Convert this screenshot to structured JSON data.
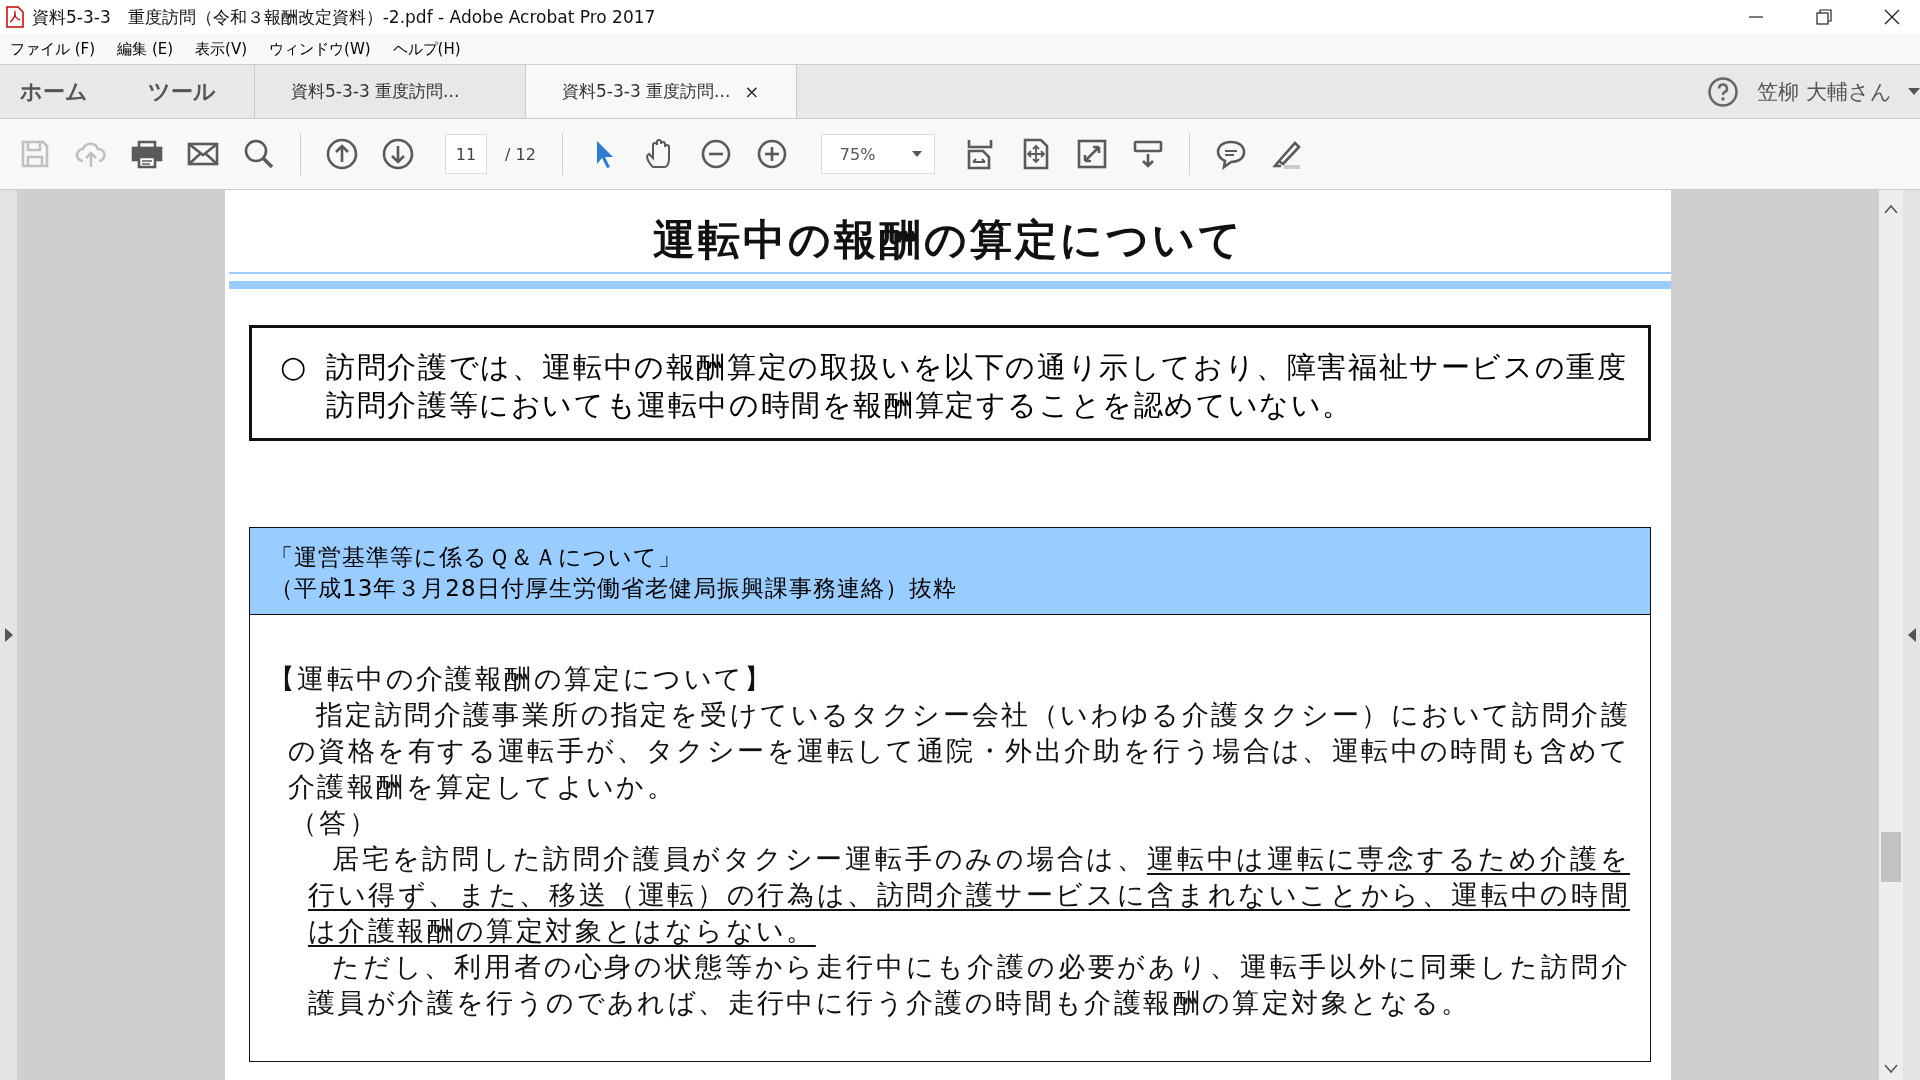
{
  "window": {
    "title": "資料5-3-3　重度訪問（令和３報酬改定資料）-2.pdf - Adobe Acrobat Pro 2017"
  },
  "menu": [
    "ファイル (F)",
    "編集 (E)",
    "表示(V)",
    "ウィンドウ(W)",
    "ヘルプ(H)"
  ],
  "nav_tabs": [
    "ホーム",
    "ツール"
  ],
  "doc_tabs": [
    {
      "label": "資料5-3-3  重度訪問...",
      "selected": false
    },
    {
      "label": "資料5-3-3  重度訪問...",
      "selected": true,
      "close": "×"
    }
  ],
  "user": {
    "name": "笠柳 大輔さん"
  },
  "toolbar": {
    "group_1": [
      {
        "kind": "save",
        "disabled": true
      },
      {
        "kind": "upload",
        "disabled": true
      },
      {
        "kind": "print",
        "disabled": false
      },
      {
        "kind": "mail",
        "disabled": false
      },
      {
        "kind": "search",
        "disabled": false
      }
    ],
    "group_2": [
      {
        "kind": "up",
        "disabled": false
      },
      {
        "kind": "down",
        "disabled": false
      }
    ],
    "page": {
      "value": "11",
      "total": "/  12"
    },
    "group_3": [
      {
        "kind": "pointer",
        "selected": true
      },
      {
        "kind": "hand",
        "selected": false
      },
      {
        "kind": "zoomout",
        "selected": false
      },
      {
        "kind": "zoomin",
        "selected": false
      }
    ],
    "zoom": {
      "value": "75%"
    },
    "group_4": [
      {
        "kind": "fitwidth"
      },
      {
        "kind": "fitpage"
      },
      {
        "kind": "fullscreen"
      },
      {
        "kind": "readmode"
      }
    ],
    "group_5": [
      {
        "kind": "comment"
      },
      {
        "kind": "highlight"
      }
    ]
  },
  "document": {
    "title": "運転中の報酬の算定について",
    "summary": {
      "bullet": "○",
      "text": "訪問介護では、運転中の報酬算定の取扱いを以下の通り示しており、障害福祉サービスの重度訪問介護等においても運転中の時間を報酬算定することを認めていない。"
    },
    "source": [
      "「運営基準等に係るＱ＆Ａについて」",
      "（平成13年３月28日付厚生労働省老健局振興課事務連絡）抜粋"
    ],
    "qa": {
      "heading": "【運転中の介護報酬の算定について】",
      "question": "指定訪問介護事業所の指定を受けているタクシー会社（いわゆる介護タクシー）において訪問介護の資格を有する運転手が、タクシーを運転して通院・外出介助を行う場合は、運転中の時間も含めて介護報酬を算定してよいか。",
      "answer_label": "（答）",
      "answers": [
        [
          {
            "text": "居宅を訪問した訪問介護員がタクシー運転手のみの場合は、",
            "underlined": false
          },
          {
            "text": "運転中は運転に専念するため介護を行い得ず、また、移送（運転）の行為は、訪問介護サービスに含まれないことから、運転中の時間は介護報酬の算定対象とはならない。",
            "underlined": true
          }
        ],
        [
          {
            "text": "ただし、利用者の心身の状態等から走行中にも介護の必要があり、運転手以外に同乗した訪問介護員が介護を行うのであれば、走行中に行う介護の時間も介護報酬の算定対象となる。",
            "underlined": false
          }
        ]
      ]
    }
  }
}
